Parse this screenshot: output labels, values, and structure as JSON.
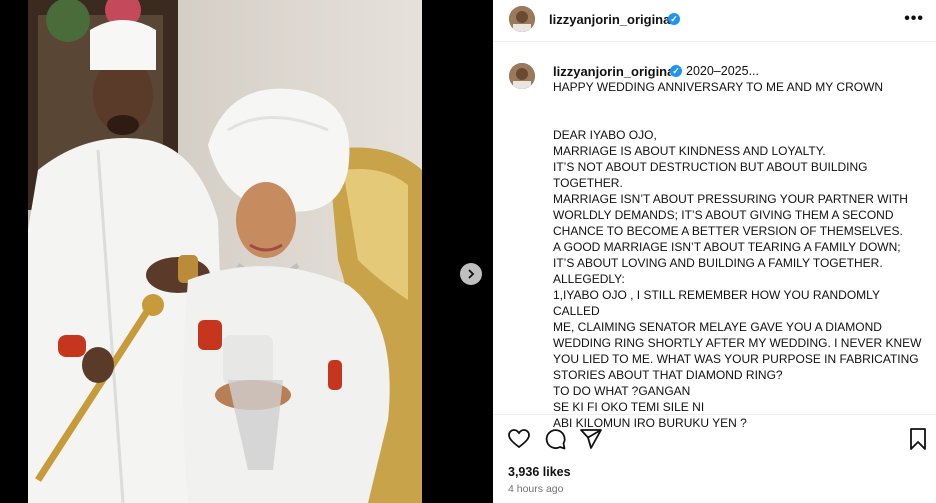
{
  "post": {
    "username": "lizzyanjorin_original",
    "date_range": "2020–2025...",
    "caption": "HAPPY WEDDING ANNIVERSARY TO ME AND MY CROWN\n\n\nDEAR IYABO OJO,\nMARRIAGE IS ABOUT KINDNESS AND LOYALTY.\nIT’S NOT ABOUT DESTRUCTION BUT ABOUT BUILDING\nTOGETHER.\nMARRIAGE ISN’T ABOUT PRESSURING YOUR PARTNER WITH\nWORLDLY DEMANDS; IT’S ABOUT GIVING THEM A SECOND\nCHANCE TO BECOME A BETTER VERSION OF THEMSELVES.\nA GOOD MARRIAGE ISN’T ABOUT TEARING A FAMILY DOWN;\nIT’S ABOUT LOVING AND BUILDING A FAMILY TOGETHER.\nALLEGEDLY:\n1,IYABO OJO , I STILL REMEMBER HOW YOU RANDOMLY CALLED\nME, CLAIMING SENATOR MELAYE GAVE YOU A DIAMOND\nWEDDING RING SHORTLY AFTER MY WEDDING. I NEVER KNEW\nYOU LIED TO ME. WHAT WAS YOUR PURPOSE IN FABRICATING\nSTORIES ABOUT THAT DIAMOND RING?\nTO DO WHAT ?GANGAN\nSE KI FI OKO TEMI SILE NI\nABI KILOMUN IRO BURUKU YEN ?",
    "likes": "3,936 likes",
    "time_ago": "4 hours ago"
  },
  "icons": {
    "verified": "verified-badge-icon",
    "more": "more-options-icon",
    "like": "heart-icon",
    "comment": "comment-icon",
    "share": "share-icon",
    "save": "bookmark-icon",
    "next": "chevron-right-icon"
  },
  "colors": {
    "verified": "#1e96f0",
    "text": "#111111",
    "muted": "#737373"
  }
}
